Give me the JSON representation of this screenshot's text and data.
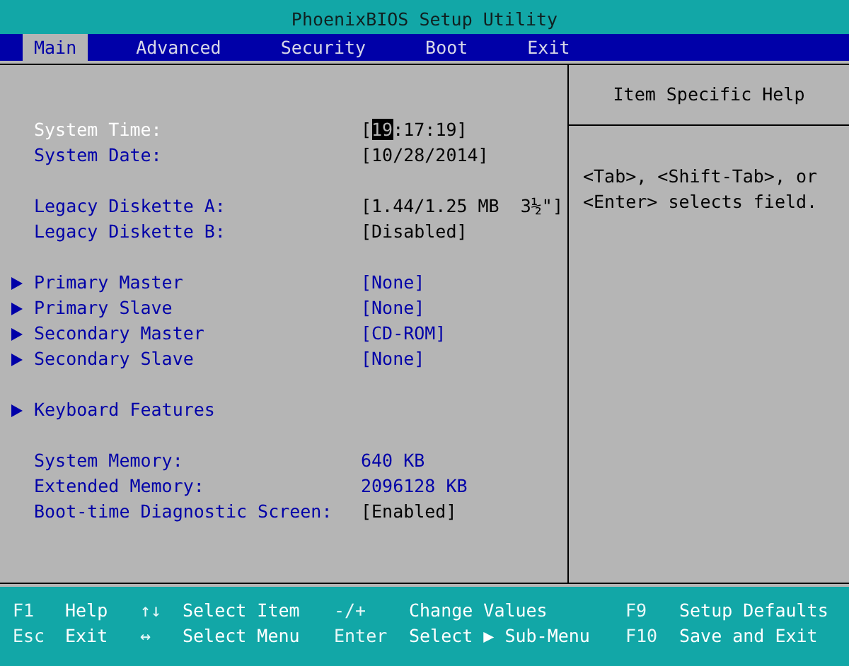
{
  "title": "PhoenixBIOS Setup Utility",
  "menu": [
    {
      "label": "Main",
      "selected": true
    },
    {
      "label": "Advanced",
      "selected": false
    },
    {
      "label": "Security",
      "selected": false
    },
    {
      "label": "Boot",
      "selected": false
    },
    {
      "label": "Exit",
      "selected": false
    }
  ],
  "groups": [
    {
      "rows": [
        {
          "label": "System Time:",
          "selected": true,
          "submenu": false,
          "editable": true,
          "value": [
            {
              "text": "[",
              "selected": false
            },
            {
              "text": "19",
              "selected": true
            },
            {
              "text": ":17:19]",
              "selected": false
            }
          ]
        },
        {
          "label": "System Date:",
          "selected": false,
          "submenu": false,
          "editable": true,
          "value": [
            {
              "text": "[10/28/2014]",
              "selected": false
            }
          ]
        }
      ]
    },
    {
      "rows": [
        {
          "label": "Legacy Diskette A:",
          "selected": false,
          "submenu": false,
          "editable": true,
          "value": [
            {
              "text": "[1.44/1.25 MB  3½\"]",
              "selected": false
            }
          ]
        },
        {
          "label": "Legacy Diskette B:",
          "selected": false,
          "submenu": false,
          "editable": true,
          "value": [
            {
              "text": "[Disabled]",
              "selected": false
            }
          ]
        }
      ]
    },
    {
      "rows": [
        {
          "label": "Primary Master",
          "selected": false,
          "submenu": true,
          "editable": false,
          "value": [
            {
              "text": "[None]",
              "selected": false
            }
          ]
        },
        {
          "label": "Primary Slave",
          "selected": false,
          "submenu": true,
          "editable": false,
          "value": [
            {
              "text": "[None]",
              "selected": false
            }
          ]
        },
        {
          "label": "Secondary Master",
          "selected": false,
          "submenu": true,
          "editable": false,
          "value": [
            {
              "text": "[CD-ROM]",
              "selected": false
            }
          ]
        },
        {
          "label": "Secondary Slave",
          "selected": false,
          "submenu": true,
          "editable": false,
          "value": [
            {
              "text": "[None]",
              "selected": false
            }
          ]
        }
      ]
    },
    {
      "rows": [
        {
          "label": "Keyboard Features",
          "selected": false,
          "submenu": true
        }
      ]
    },
    {
      "rows": [
        {
          "label": "System Memory:",
          "selected": false,
          "submenu": false,
          "editable": false,
          "value": [
            {
              "text": "640 KB",
              "selected": false
            }
          ]
        },
        {
          "label": "Extended Memory:",
          "selected": false,
          "submenu": false,
          "editable": false,
          "value": [
            {
              "text": "2096128 KB",
              "selected": false
            }
          ]
        },
        {
          "label": "Boot-time Diagnostic Screen:",
          "selected": false,
          "submenu": false,
          "editable": true,
          "value": [
            {
              "text": "[Enabled]",
              "selected": false
            }
          ]
        }
      ]
    }
  ],
  "help": {
    "title": "Item Specific Help",
    "text": "<Tab>, <Shift-Tab>, or <Enter> selects field."
  },
  "keys": [
    [
      {
        "key": "F1",
        "action": "Help"
      },
      {
        "key": "↑↓",
        "action": "Select Item"
      },
      {
        "key": "-/+",
        "action": "Change Values"
      },
      {
        "key": "F9",
        "action": "Setup Defaults"
      }
    ],
    [
      {
        "key": "Esc",
        "action": "Exit"
      },
      {
        "key": "↔",
        "action": "Select Menu"
      },
      {
        "key": "Enter",
        "action": "Select ▶ Sub-Menu"
      },
      {
        "key": "F10",
        "action": "Save and Exit"
      }
    ]
  ]
}
